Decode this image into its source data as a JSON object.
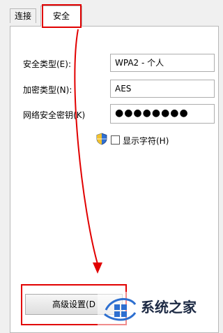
{
  "tabs": {
    "connection": "连接",
    "security": "安全"
  },
  "fields": {
    "security_type_label": "安全类型(E):",
    "security_type_value": "WPA2 - 个人",
    "encryption_type_label": "加密类型(N):",
    "encryption_type_value": "AES",
    "network_key_label": "网络安全密钥(K)",
    "network_key_value": "●●●●●●●●"
  },
  "show_characters_label": "显示字符(H)",
  "advanced_button_label": "高级设置(D",
  "watermark_text": "系统之家",
  "colors": {
    "highlight": "#e10000",
    "watermark_text": "#1d2a44"
  }
}
